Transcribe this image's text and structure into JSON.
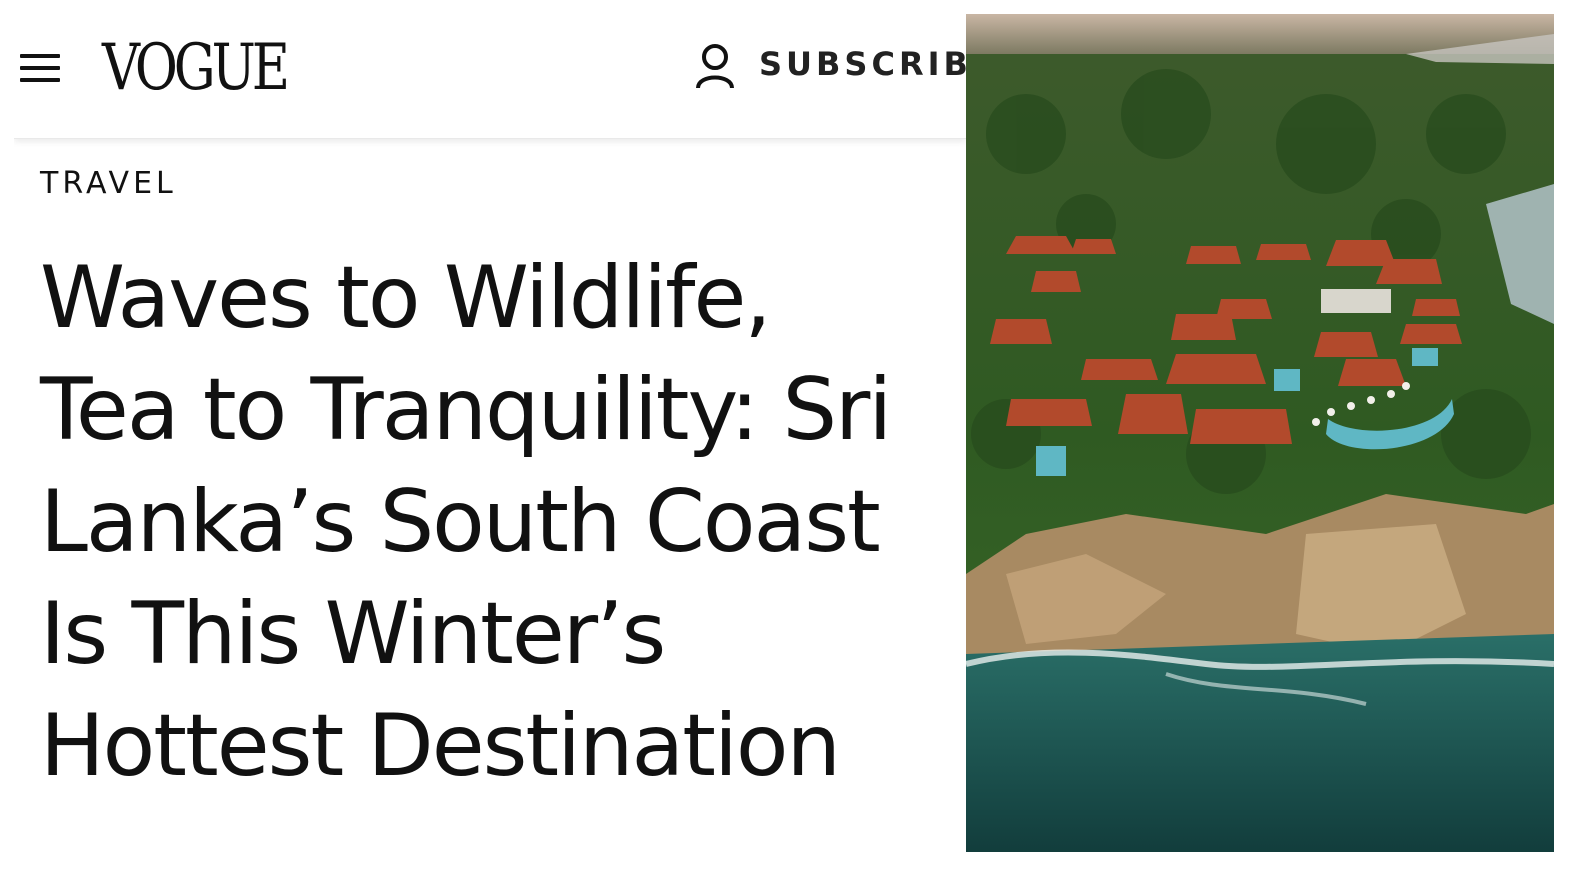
{
  "header": {
    "menu_icon": "hamburger-menu-icon",
    "logo": "VOGUE",
    "account_icon": "user-icon",
    "subscribe_label": "SUBSCRIBE"
  },
  "article": {
    "section": "TRAVEL",
    "headline_lines": [
      "Waves to Wildlife,",
      "Tea to Tranquility: Sri",
      "Lanka’s South Coast",
      "Is This Winter’s",
      "Hottest Destination"
    ]
  },
  "hero_image": {
    "subject": "aerial-coastal-resort-photo",
    "colors": {
      "sky": "#b9a99a",
      "forest": "#2f5a22",
      "roof": "#b24a2c",
      "cliff": "#a88a62",
      "sea": "#1f5a55",
      "pool": "#5fb7c4"
    }
  }
}
